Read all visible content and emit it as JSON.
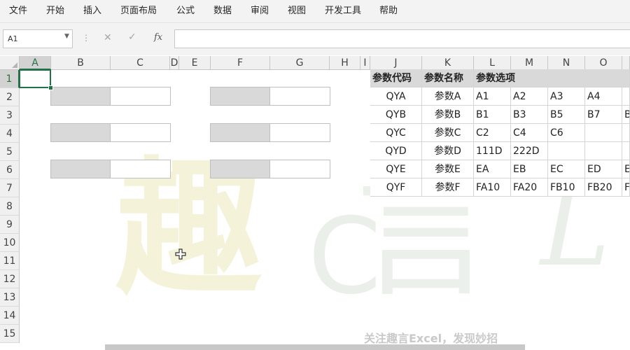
{
  "menu": [
    "文件",
    "开始",
    "插入",
    "页面布局",
    "公式",
    "数据",
    "审阅",
    "视图",
    "开发工具",
    "帮助"
  ],
  "formula_bar": {
    "name_box": "A1",
    "dots_icon": "more-dots-icon",
    "cancel_icon": "cancel-x-icon",
    "enter_icon": "enter-check-icon",
    "fx_label": "fx",
    "formula": ""
  },
  "columns": [
    "A",
    "B",
    "C",
    "D",
    "E",
    "F",
    "G",
    "H",
    "I",
    "J",
    "K",
    "L",
    "M",
    "N",
    "O"
  ],
  "rows": [
    "1",
    "2",
    "3",
    "4",
    "5",
    "6",
    "7",
    "8",
    "9",
    "10",
    "11",
    "12",
    "13",
    "14",
    "15"
  ],
  "selected_cell": "A1",
  "param_table": {
    "headers": [
      "参数代码",
      "参数名称",
      "参数选项"
    ],
    "rows": [
      {
        "code": "QYA",
        "name": "参数A",
        "options": [
          "A1",
          "A2",
          "A3",
          "A4",
          ""
        ]
      },
      {
        "code": "QYB",
        "name": "参数B",
        "options": [
          "B1",
          "B3",
          "B5",
          "B7",
          "B"
        ]
      },
      {
        "code": "QYC",
        "name": "参数C",
        "options": [
          "C2",
          "C4",
          "C6",
          "",
          ""
        ]
      },
      {
        "code": "QYD",
        "name": "参数D",
        "options": [
          "111D",
          "222D",
          "",
          "",
          ""
        ]
      },
      {
        "code": "QYE",
        "name": "参数E",
        "options": [
          "EA",
          "EB",
          "EC",
          "ED",
          "E"
        ]
      },
      {
        "code": "QYF",
        "name": "参数F",
        "options": [
          "FA10",
          "FA20",
          "FB10",
          "FB20",
          "F"
        ]
      }
    ]
  },
  "watermark": {
    "char1": "趣",
    "char2": "C",
    "char3": "言",
    "char4": "L"
  },
  "footer_note": "关注趣言Excel，发现妙招",
  "colors": {
    "accent": "#217346",
    "label_fill": "#d9d9d9",
    "header_fill": "#d9d9d9"
  }
}
